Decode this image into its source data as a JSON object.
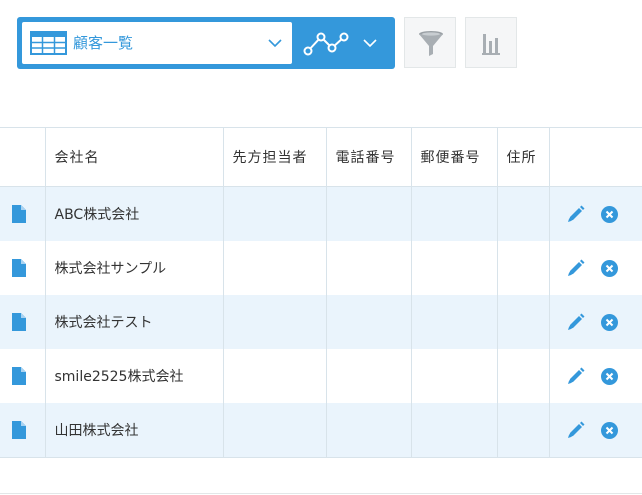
{
  "toolbar": {
    "view_select": {
      "label": "顧客一覧",
      "icon": "table-icon"
    },
    "graph_button": {
      "icon": "line-graph-icon"
    },
    "filter_button": {
      "icon": "funnel-icon"
    },
    "summary_button": {
      "icon": "bar-chart-icon"
    }
  },
  "colors": {
    "accent": "#3498db",
    "row_stripe": "#eaf4fc",
    "border": "#d8e3ea",
    "delete": "#3498db"
  },
  "table": {
    "columns": [
      "会社名",
      "先方担当者",
      "電話番号",
      "郵便番号",
      "住所"
    ],
    "rows": [
      {
        "company": "ABC株式会社",
        "contact": "",
        "phone": "",
        "zip": "",
        "address": ""
      },
      {
        "company": "株式会社サンプル",
        "contact": "",
        "phone": "",
        "zip": "",
        "address": ""
      },
      {
        "company": "株式会社テスト",
        "contact": "",
        "phone": "",
        "zip": "",
        "address": ""
      },
      {
        "company": "smile2525株式会社",
        "contact": "",
        "phone": "",
        "zip": "",
        "address": ""
      },
      {
        "company": "山田株式会社",
        "contact": "",
        "phone": "",
        "zip": "",
        "address": ""
      }
    ]
  }
}
